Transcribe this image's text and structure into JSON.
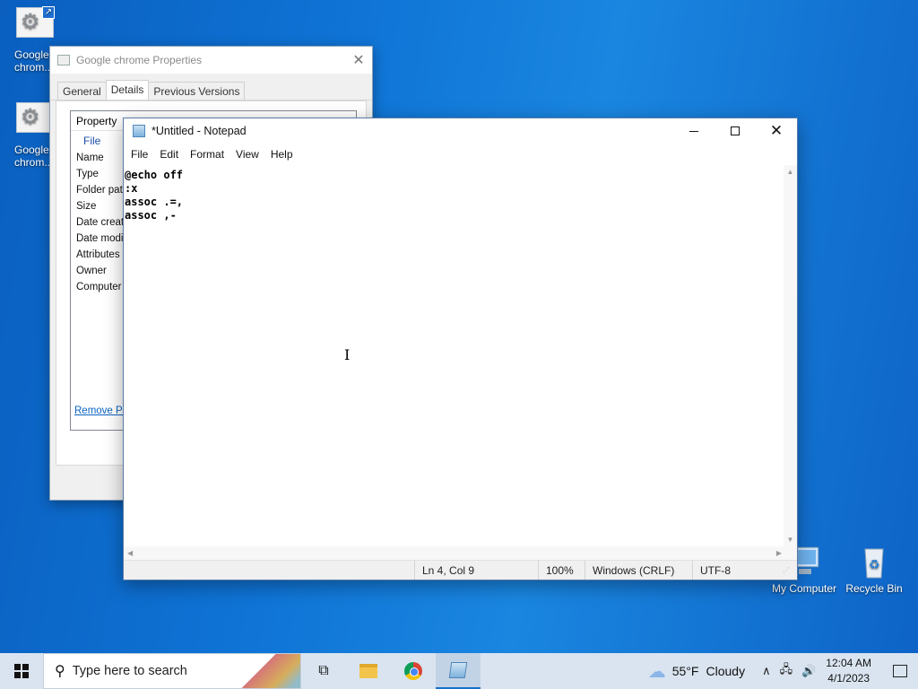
{
  "desktop": {
    "icons": [
      {
        "label": "Google chrom..."
      },
      {
        "label": "Google chrom..."
      },
      {
        "label": "My Computer"
      },
      {
        "label": "Recycle Bin"
      }
    ]
  },
  "properties": {
    "title": "Google chrome Properties",
    "tabs": [
      "General",
      "Details",
      "Previous Versions"
    ],
    "active_tab": "Details",
    "column_header": "Property",
    "group": "File",
    "rows": [
      "Name",
      "Type",
      "Folder path",
      "Size",
      "Date create",
      "Date modifi",
      "Attributes",
      "Owner",
      "Computer"
    ],
    "remove_link": "Remove Prop"
  },
  "notepad": {
    "title": "*Untitled - Notepad",
    "menu": [
      "File",
      "Edit",
      "Format",
      "View",
      "Help"
    ],
    "content": "@echo off\n:x\nassoc .=,\nassoc ,-",
    "status": {
      "position": "Ln 4, Col 9",
      "zoom": "100%",
      "line_ending": "Windows (CRLF)",
      "encoding": "UTF-8"
    }
  },
  "taskbar": {
    "search_placeholder": "Type here to search",
    "weather_temp": "55°F",
    "weather_cond": "Cloudy",
    "time": "12:04 AM",
    "date": "4/1/2023"
  }
}
